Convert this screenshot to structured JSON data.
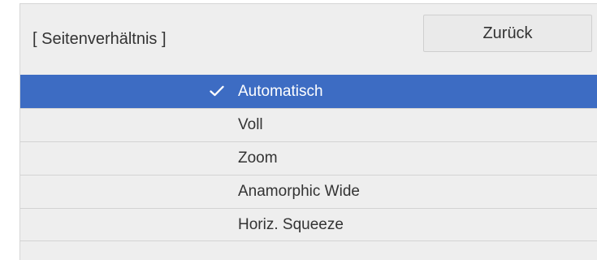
{
  "menu": {
    "title": "[ Seitenverhältnis ]",
    "back_label": "Zurück"
  },
  "options": [
    {
      "label": "Automatisch",
      "selected": true,
      "icon": "checkmark-icon"
    },
    {
      "label": "Voll",
      "selected": false
    },
    {
      "label": "Zoom",
      "selected": false
    },
    {
      "label": "Anamorphic Wide",
      "selected": false
    },
    {
      "label": "Horiz. Squeeze",
      "selected": false
    }
  ],
  "colors": {
    "selected_background": "#3d6cc3",
    "menu_background": "#eeeeee",
    "text": "#333333"
  }
}
